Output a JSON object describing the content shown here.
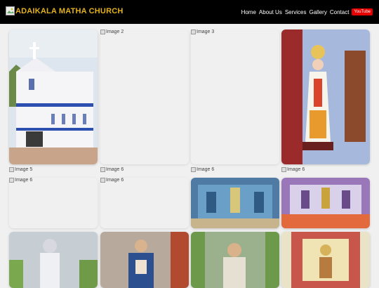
{
  "header": {
    "title": "ADAIKALA MATHA CHURCH",
    "nav": [
      "Home",
      "About Us",
      "Services",
      "Gallery",
      "Contact"
    ],
    "youtube_label": "YouTube",
    "colors": {
      "background": "#000000",
      "title": "#e3b21d",
      "youtube": "#e60000"
    }
  },
  "gallery": {
    "broken_alts": [
      "Image 2",
      "Image 3",
      "Image 5",
      "Image 6",
      "Image 6",
      "Image 6",
      "Image 6",
      "Image 6"
    ]
  }
}
